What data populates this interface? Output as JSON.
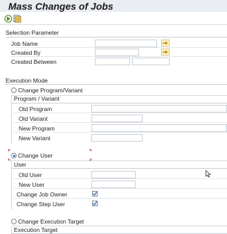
{
  "title": "Mass Changes of Jobs",
  "toolbar": {
    "buttons": [
      {
        "icon": "execute-icon"
      },
      {
        "icon": "save-variant-icon"
      }
    ]
  },
  "selection": {
    "header": "Selection Parameter",
    "job_name_label": "Job Name",
    "job_name_value": "",
    "created_by_label": "Created By",
    "created_by_value": "",
    "created_between_label": "Created Between",
    "created_from_value": "",
    "created_to_value": ""
  },
  "execution": {
    "header": "Execution Mode",
    "change_program_label": "Change Program/Variant",
    "change_program_selected": false,
    "program_group_title": "Program / Variant",
    "old_program_label": "Old Program",
    "old_program_value": "",
    "old_variant_label": "Old Variant",
    "old_variant_value": "",
    "new_program_label": "New Program",
    "new_program_value": "",
    "new_variant_label": "New Variant",
    "new_variant_value": "",
    "change_user_label": "Change User",
    "change_user_selected": true,
    "user_group_title": "User",
    "old_user_label": "Old User",
    "old_user_value": "",
    "new_user_label": "New User",
    "new_user_value": "",
    "change_job_owner_label": "Change Job Owner",
    "change_job_owner_checked": true,
    "change_step_user_label": "Change Step User",
    "change_step_user_checked": true,
    "change_target_label": "Change Execution Target",
    "change_target_selected": false,
    "target_group_title": "Execution Target"
  },
  "colors": {
    "accent": "#2a5ea8",
    "title_bar": "#e9edf1",
    "select_button": "#fff7d6"
  }
}
